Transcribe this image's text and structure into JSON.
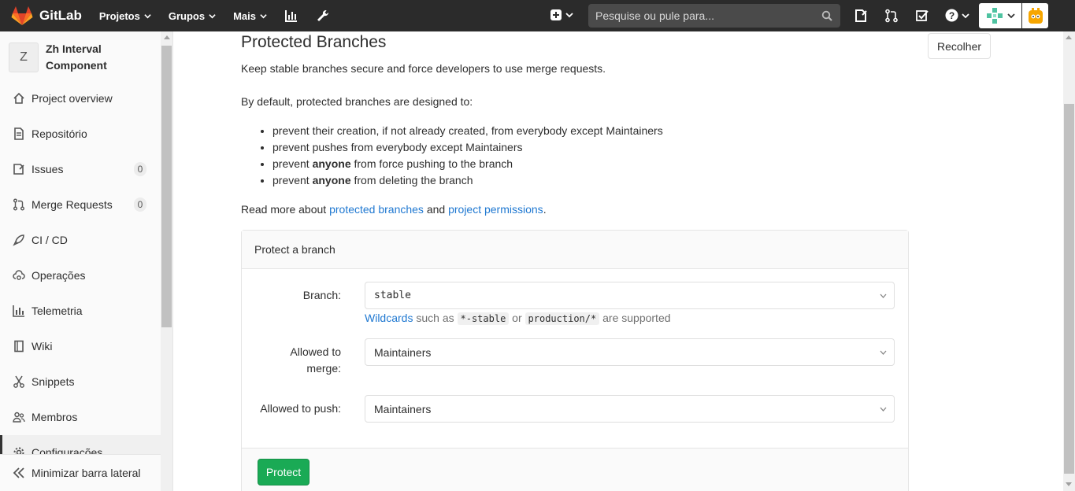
{
  "navbar": {
    "brand": "GitLab",
    "links": [
      "Projetos",
      "Grupos",
      "Mais"
    ],
    "search_placeholder": "Pesquise ou pule para..."
  },
  "sidebar": {
    "project_initial": "Z",
    "project_name": "Zh Interval Component",
    "items": [
      {
        "label": "Project overview",
        "icon": "home-icon"
      },
      {
        "label": "Repositório",
        "icon": "document-icon"
      },
      {
        "label": "Issues",
        "icon": "issues-icon",
        "badge": "0"
      },
      {
        "label": "Merge Requests",
        "icon": "merge-request-icon",
        "badge": "0"
      },
      {
        "label": "CI / CD",
        "icon": "rocket-icon"
      },
      {
        "label": "Operações",
        "icon": "cloud-gear-icon"
      },
      {
        "label": "Telemetria",
        "icon": "chart-icon"
      },
      {
        "label": "Wiki",
        "icon": "book-icon"
      },
      {
        "label": "Snippets",
        "icon": "scissors-icon"
      },
      {
        "label": "Membros",
        "icon": "users-icon"
      },
      {
        "label": "Configurações",
        "icon": "gear-icon"
      }
    ],
    "collapse_label": "Minimizar barra lateral"
  },
  "main": {
    "collapse_button": "Recolher",
    "title": "Protected Branches",
    "intro": "Keep stable branches secure and force developers to use merge requests.",
    "default_text": "By default, protected branches are designed to:",
    "bullets": [
      {
        "before": "prevent their creation, if not already created, from everybody except Maintainers",
        "bold": "",
        "after": ""
      },
      {
        "before": "prevent pushes from everybody except Maintainers",
        "bold": "",
        "after": ""
      },
      {
        "before": "prevent ",
        "bold": "anyone",
        "after": " from force pushing to the branch"
      },
      {
        "before": "prevent ",
        "bold": "anyone",
        "after": " from deleting the branch"
      }
    ],
    "read_more_prefix": "Read more about ",
    "read_more_link1": "protected branches",
    "read_more_middle": " and ",
    "read_more_link2": "project permissions",
    "read_more_suffix": ".",
    "card": {
      "header": "Protect a branch",
      "branch_label": "Branch:",
      "branch_value": "stable",
      "help_link": "Wildcards",
      "help_such_as": " such as ",
      "help_code1": "*-stable",
      "help_or": " or ",
      "help_code2": "production/*",
      "help_suffix": " are supported",
      "merge_label_line1": "Allowed to",
      "merge_label_line2": "merge:",
      "merge_value": "Maintainers",
      "push_label": "Allowed to push:",
      "push_value": "Maintainers",
      "protect_button": "Protect"
    }
  },
  "colors": {
    "navbar_bg": "#2b2b2b",
    "link": "#1f78d1",
    "protect_green": "#1aaa55"
  }
}
